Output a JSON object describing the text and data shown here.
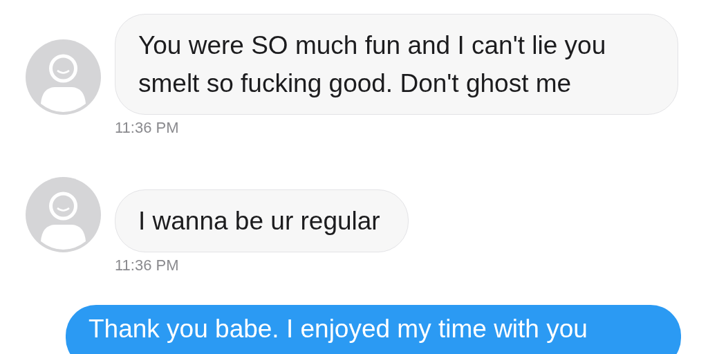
{
  "messages": [
    {
      "kind": "incoming",
      "text": "You were SO much fun and I can't lie you smelt so fucking good. Don't ghost me",
      "time": "11:36 PM"
    },
    {
      "kind": "incoming",
      "text": "I wanna be ur regular",
      "time": "11:36 PM"
    },
    {
      "kind": "outgoing",
      "text": "Thank you babe. I enjoyed my time with you"
    }
  ]
}
